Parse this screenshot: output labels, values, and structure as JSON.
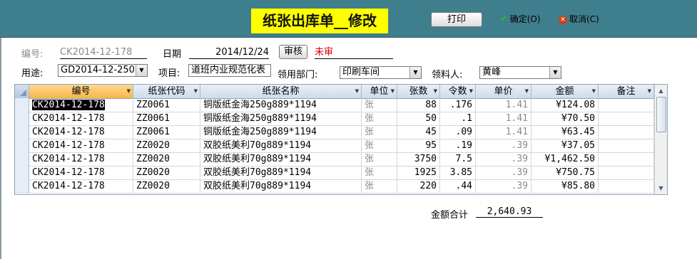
{
  "header": {
    "title": "纸张出库单__修改",
    "print_label": "打印",
    "confirm_label": "确定(O)",
    "cancel_label": "取消(C)",
    "colors": {
      "bar": "#3f7e8c",
      "title_bg": "#ffff00"
    }
  },
  "form": {
    "code_label": "编号:",
    "code_value": "CK2014-12-178",
    "date_label": "日期",
    "date_value": "2014/12/24",
    "audit_button": "审核",
    "audit_status": "未审",
    "usage_label": "用途:",
    "usage_value": "GD2014-12-250",
    "project_label": "项目:",
    "project_value": "道班内业规范化表",
    "dept_label": "领用部门:",
    "dept_value": "印刷车间",
    "receiver_label": "领料人:",
    "receiver_value": "黄峰"
  },
  "grid": {
    "columns": [
      "编号",
      "纸张代码",
      "纸张名称",
      "单位",
      "张数",
      "令数",
      "单价",
      "金额",
      "备注"
    ],
    "rows": [
      [
        "CK2014-12-178",
        "ZZ0061",
        "铜版纸金海250g889*1194",
        "张",
        "88",
        ".176",
        "1.41",
        "¥124.08",
        ""
      ],
      [
        "CK2014-12-178",
        "ZZ0061",
        "铜版纸金海250g889*1194",
        "张",
        "50",
        ".1",
        "1.41",
        "¥70.50",
        ""
      ],
      [
        "CK2014-12-178",
        "ZZ0061",
        "铜版纸金海250g889*1194",
        "张",
        "45",
        ".09",
        "1.41",
        "¥63.45",
        ""
      ],
      [
        "CK2014-12-178",
        "ZZ0020",
        "双胶纸美利70g889*1194",
        "张",
        "95",
        ".19",
        ".39",
        "¥37.05",
        ""
      ],
      [
        "CK2014-12-178",
        "ZZ0020",
        "双胶纸美利70g889*1194",
        "张",
        "3750",
        "7.5",
        ".39",
        "¥1,462.50",
        ""
      ],
      [
        "CK2014-12-178",
        "ZZ0020",
        "双胶纸美利70g889*1194",
        "张",
        "1925",
        "3.85",
        ".39",
        "¥750.75",
        ""
      ],
      [
        "CK2014-12-178",
        "ZZ0020",
        "双胶纸美利70g889*1194",
        "张",
        "220",
        ".44",
        ".39",
        "¥85.80",
        ""
      ]
    ]
  },
  "footer": {
    "total_label": "金额合计",
    "total_value": "2,640.93"
  }
}
